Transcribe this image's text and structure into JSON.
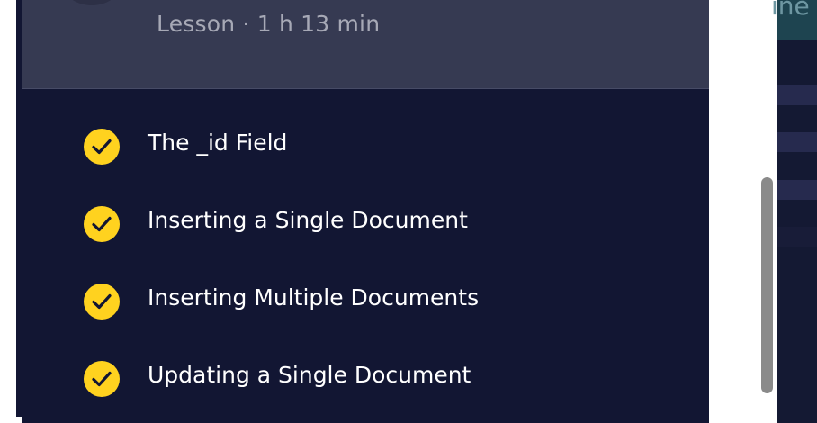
{
  "lesson": {
    "meta": "Lesson · 1 h 13 min"
  },
  "lessons": [
    {
      "title": "The _id Field",
      "completed": true,
      "icon": "check-circle-icon"
    },
    {
      "title": "Inserting a Single Document",
      "completed": true,
      "icon": "check-circle-icon"
    },
    {
      "title": "Inserting Multiple Documents",
      "completed": true,
      "icon": "check-circle-icon"
    },
    {
      "title": "Updating a Single Document",
      "completed": true,
      "icon": "check-circle-icon"
    }
  ],
  "right_panel": {
    "partial_text": "ine"
  },
  "colors": {
    "panel_bg": "#121633",
    "header_bg": "#363a52",
    "check_bg": "#ffd21f",
    "check_mark": "#121633",
    "title_text": "#ffffff",
    "meta_text": "#a7a9b6"
  }
}
